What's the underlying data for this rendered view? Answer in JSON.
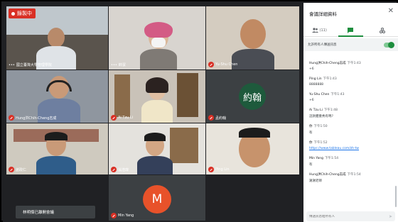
{
  "recording": {
    "label": "錄製中"
  },
  "tiles": [
    {
      "name": "國立臺灣大學管理學院",
      "mic_muted": false,
      "more": true
    },
    {
      "name": "帥潔",
      "mic_muted": false,
      "more": true
    },
    {
      "name": "Yu-Shu Chen",
      "mic_muted": true,
      "more": false
    },
    {
      "name": "Hung洪Chih-Cheng志成",
      "mic_muted": true,
      "more": false
    },
    {
      "name": "Ai Tzu Li",
      "mic_muted": true,
      "more": false
    },
    {
      "name": "孟約翰",
      "mic_muted": true,
      "more": false,
      "avatar_text": "約翰",
      "avatar_color": "#1e5a3c"
    },
    {
      "name": "謝政仁",
      "mic_muted": true,
      "more": false
    },
    {
      "name": "翁浩瑋",
      "mic_muted": true,
      "more": false
    },
    {
      "name": "Ping Lin",
      "mic_muted": true,
      "more": false
    },
    {
      "name": "Min Yang",
      "mic_muted": true,
      "more": false,
      "avatar_text": "M",
      "avatar_color": "#e8522a"
    }
  ],
  "toast": {
    "text": "林明傑已離開會議"
  },
  "panel": {
    "title": "會議詳細資料",
    "close_icon": "close-icon",
    "tabs": [
      {
        "icon": "people-icon",
        "label": "(11)",
        "active": false
      },
      {
        "icon": "chat-icon",
        "label": "",
        "active": true
      },
      {
        "icon": "activities-icon",
        "label": "",
        "active": false
      }
    ],
    "toggle": {
      "label": "允許所有人傳送訊息",
      "on": true
    },
    "messages": [
      {
        "sender": "Hung洪Chih-Cheng志成",
        "time": "下午1:43",
        "text": "+6"
      },
      {
        "sender": "Ping Lin",
        "time": "下午1:43",
        "text": "8888888"
      },
      {
        "sender": "Yu-Shu Chen",
        "time": "下午1:43",
        "text": "+6"
      },
      {
        "sender": "Ai Tzu Li",
        "time": "下午1:48",
        "text": "這款體重秀有嗎？"
      },
      {
        "sender": "你",
        "time": "下午1:50",
        "text": "有"
      },
      {
        "sender": "你",
        "time": "下午1:52",
        "text": "https://www.tableau.com/zh-tw",
        "link": true
      },
      {
        "sender": "Min Yang",
        "time": "下午1:54",
        "text": "有"
      },
      {
        "sender": "Hung洪Chih-Cheng志成",
        "time": "下午1:54",
        "text": "謝謝老師"
      }
    ],
    "compose_placeholder": "傳送訊息給所有人"
  }
}
